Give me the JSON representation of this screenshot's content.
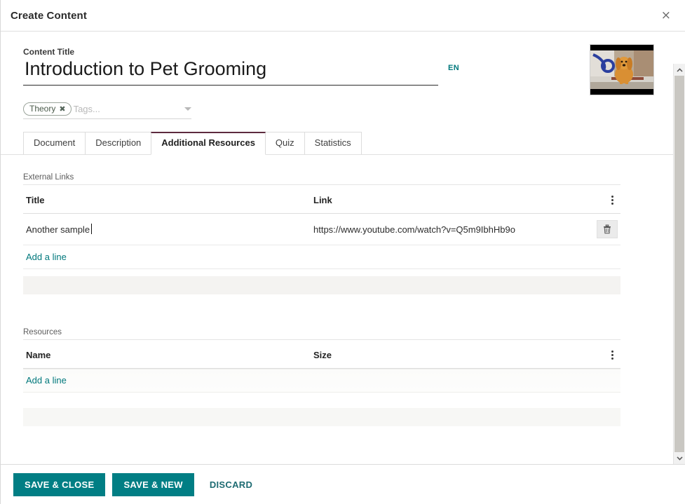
{
  "dialog": {
    "title": "Create Content",
    "close_label": "×"
  },
  "form": {
    "content_title_label": "Content Title",
    "content_title_value": "Introduction to Pet Grooming",
    "content_title_placeholder": "Content Title",
    "language_badge": "EN",
    "tags": {
      "chips": [
        {
          "label": "Theory",
          "remove_label": "✖"
        }
      ],
      "placeholder": "Tags..."
    },
    "thumbnail_alt": "Dog being groomed in a tub"
  },
  "tabs": [
    {
      "label": "Document",
      "active": false
    },
    {
      "label": "Description",
      "active": false
    },
    {
      "label": "Additional Resources",
      "active": true
    },
    {
      "label": "Quiz",
      "active": false
    },
    {
      "label": "Statistics",
      "active": false
    }
  ],
  "external_links": {
    "section_label": "External Links",
    "columns": [
      "Title",
      "Link"
    ],
    "rows": [
      {
        "title": "Another sample",
        "link": "https://www.youtube.com/watch?v=Q5m9IbhHb9o",
        "delete_label": "Delete row"
      }
    ],
    "add_line_label": "Add a line",
    "options_label": "Optional columns"
  },
  "resources": {
    "section_label": "Resources",
    "columns": [
      "Name",
      "Size"
    ],
    "rows": [],
    "add_line_label": "Add a line",
    "options_label": "Optional columns"
  },
  "footer": {
    "save_close_label": "SAVE & CLOSE",
    "save_new_label": "SAVE & NEW",
    "discard_label": "DISCARD"
  },
  "colors": {
    "accent_teal": "#017e84",
    "link_teal": "#00787c",
    "active_tab_border": "#5d2b3e",
    "row_ghost": "#f4f3f1"
  }
}
